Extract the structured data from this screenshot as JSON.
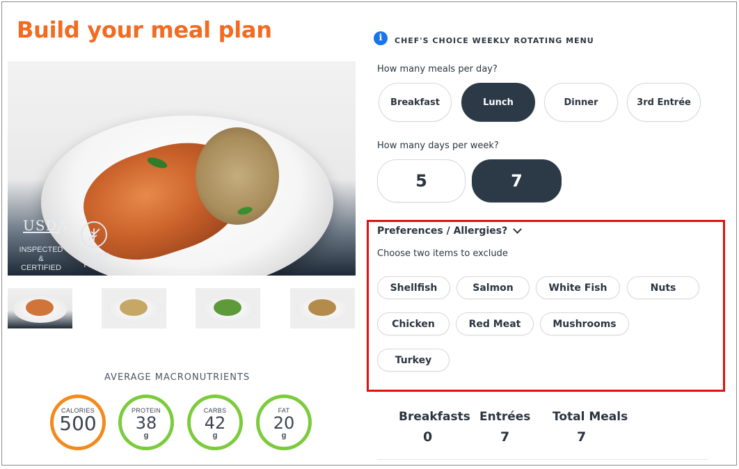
{
  "page": {
    "title": "Build your meal plan",
    "info_text": "CHEF'S CHOICE WEEKLY ROTATING MENU"
  },
  "hero": {
    "badges": {
      "usda_mark": "USDA",
      "usda_line1": "INSPECTED",
      "usda_line2": "& CERTIFIED",
      "gf_line1": "GLUTEN",
      "gf_line2": "FREE"
    }
  },
  "macros": {
    "title": "AVERAGE MACRONUTRIENTS",
    "items": [
      {
        "label": "CALORIES",
        "value": "500",
        "unit": ""
      },
      {
        "label": "PROTEIN",
        "value": "38",
        "unit": "g"
      },
      {
        "label": "CARBS",
        "value": "42",
        "unit": "g"
      },
      {
        "label": "FAT",
        "value": "20",
        "unit": "g"
      }
    ]
  },
  "meals": {
    "question": "How many meals per day?",
    "options": [
      {
        "label": "Breakfast",
        "selected": false
      },
      {
        "label": "Lunch",
        "selected": true
      },
      {
        "label": "Dinner",
        "selected": false
      },
      {
        "label": "3rd Entrée",
        "selected": false
      }
    ]
  },
  "days": {
    "question": "How many days per week?",
    "options": [
      {
        "label": "5",
        "selected": false
      },
      {
        "label": "7",
        "selected": true
      }
    ]
  },
  "preferences": {
    "heading": "Preferences / Allergies?",
    "subtitle": "Choose two items to exclude",
    "items": [
      "Shellfish",
      "Salmon",
      "White Fish",
      "Nuts",
      "Chicken",
      "Red Meat",
      "Mushrooms",
      "Turkey"
    ]
  },
  "summary": {
    "breakfasts_label": "Breakfasts",
    "breakfasts_value": "0",
    "entrees_label": "Entrées",
    "entrees_value": "7",
    "total_label": "Total Meals",
    "total_value": "7"
  },
  "colors": {
    "title_orange": "#f26b21",
    "selected_dark": "#2c3a48",
    "calorie_ring": "#f28a1c",
    "macro_ring": "#7bcb3c",
    "highlight_red": "#e0100f",
    "info_blue": "#1a73e8"
  }
}
